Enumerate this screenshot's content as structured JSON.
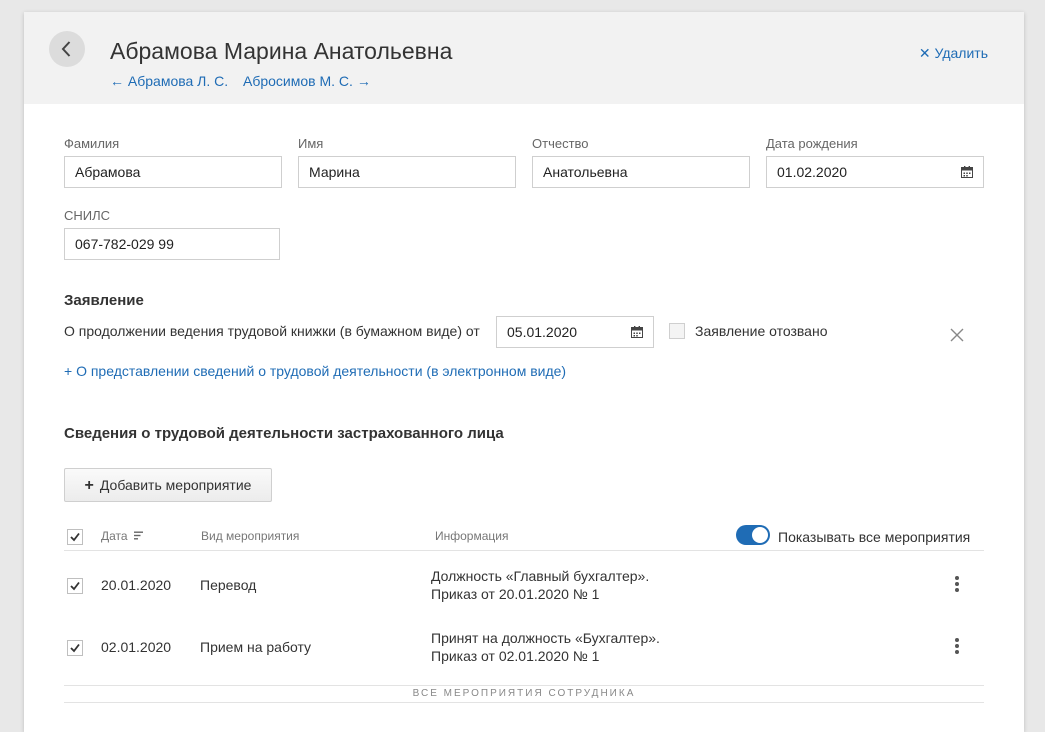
{
  "header": {
    "title": "Абрамова Марина Анатольевна",
    "prev_link": "← Абрамова Л. С.",
    "next_link": "Абросимов М. С. →",
    "delete_label": "Удалить"
  },
  "person": {
    "surname_label": "Фамилия",
    "surname_value": "Абрамова",
    "name_label": "Имя",
    "name_value": "Марина",
    "patronymic_label": "Отчество",
    "patronymic_value": "Анатольевна",
    "birthdate_label": "Дата рождения",
    "birthdate_value": "01.02.2020",
    "snils_label": "СНИЛС",
    "snils_value": "067-782-029 99"
  },
  "application": {
    "section_title": "Заявление",
    "paper_text": "О продолжении ведения трудовой книжки (в бумажном виде) от",
    "paper_date": "05.01.2020",
    "withdrawn_label": "Заявление отозвано",
    "electronic_link": "+ О представлении сведений о трудовой деятельности (в электронном виде)"
  },
  "activity": {
    "section_title": "Сведения о трудовой деятельности застрахованного лица",
    "add_button": "Добавить мероприятие",
    "col_date": "Дата",
    "col_type": "Вид мероприятия",
    "col_info": "Информация",
    "toggle_label": "Показывать все мероприятия",
    "rows": [
      {
        "date": "20.01.2020",
        "type": "Перевод",
        "info_line1": "Должность «Главный бухгалтер».",
        "info_line2": "Приказ от 20.01.2020 № 1"
      },
      {
        "date": "02.01.2020",
        "type": "Прием на работу",
        "info_line1": "Принят на должность «Бухгалтер».",
        "info_line2": "Приказ от 02.01.2020 № 1"
      }
    ],
    "footer_label": "ВСЕ МЕРОПРИЯТИЯ СОТРУДНИКА"
  },
  "colors": {
    "accent": "#1f6cb5",
    "header_bg": "#f2f2f2"
  },
  "icons": [
    "chevron-left-icon",
    "close-icon",
    "calendar-icon",
    "plus-icon",
    "checkmark-icon",
    "sort-icon",
    "kebab-menu-icon"
  ]
}
